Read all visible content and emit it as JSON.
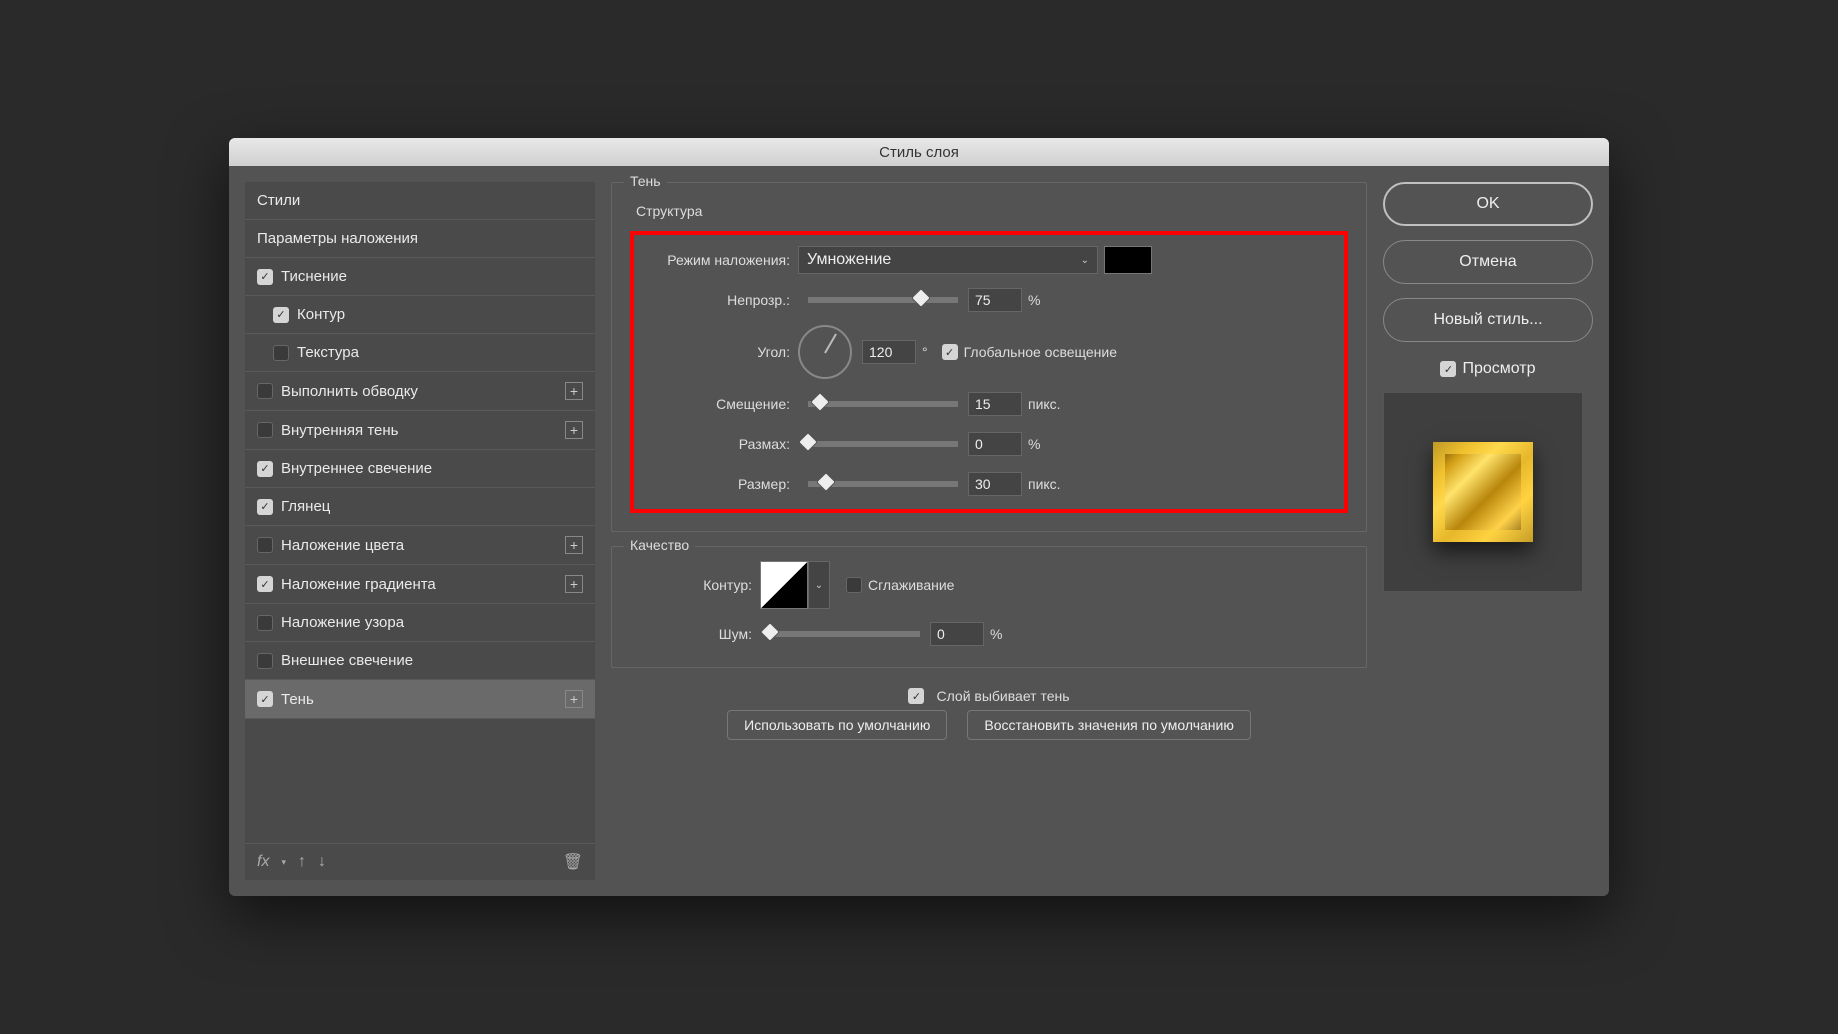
{
  "title": "Стиль слоя",
  "sidebar": {
    "styles_header": "Стили",
    "blending_options": "Параметры наложения",
    "items": [
      {
        "label": "Тиснение",
        "checked": true,
        "plus": false,
        "sub": false
      },
      {
        "label": "Контур",
        "checked": true,
        "plus": false,
        "sub": true
      },
      {
        "label": "Текстура",
        "checked": false,
        "plus": false,
        "sub": true
      },
      {
        "label": "Выполнить обводку",
        "checked": false,
        "plus": true,
        "sub": false
      },
      {
        "label": "Внутренняя тень",
        "checked": false,
        "plus": true,
        "sub": false
      },
      {
        "label": "Внутреннее свечение",
        "checked": true,
        "plus": false,
        "sub": false
      },
      {
        "label": "Глянец",
        "checked": true,
        "plus": false,
        "sub": false
      },
      {
        "label": "Наложение цвета",
        "checked": false,
        "plus": true,
        "sub": false
      },
      {
        "label": "Наложение градиента",
        "checked": true,
        "plus": true,
        "sub": false
      },
      {
        "label": "Наложение узора",
        "checked": false,
        "plus": false,
        "sub": false
      },
      {
        "label": "Внешнее свечение",
        "checked": false,
        "plus": false,
        "sub": false
      },
      {
        "label": "Тень",
        "checked": true,
        "plus": true,
        "sub": false,
        "selected": true
      }
    ],
    "fx_label": "fx"
  },
  "main": {
    "panel_title": "Тень",
    "structure": {
      "legend": "Структура",
      "blend_mode_label": "Режим наложения:",
      "blend_mode_value": "Умножение",
      "opacity_label": "Непрозр.:",
      "opacity_value": "75",
      "opacity_unit": "%",
      "angle_label": "Угол:",
      "angle_value": "120",
      "angle_unit": "°",
      "global_light_label": "Глобальное освещение",
      "global_light_checked": true,
      "distance_label": "Смещение:",
      "distance_value": "15",
      "distance_unit": "пикс.",
      "spread_label": "Размах:",
      "spread_value": "0",
      "spread_unit": "%",
      "size_label": "Размер:",
      "size_value": "30",
      "size_unit": "пикс."
    },
    "quality": {
      "legend": "Качество",
      "contour_label": "Контур:",
      "antialias_label": "Сглаживание",
      "antialias_checked": false,
      "noise_label": "Шум:",
      "noise_value": "0",
      "noise_unit": "%"
    },
    "knockout_label": "Слой выбивает тень",
    "knockout_checked": true,
    "make_default": "Использовать по умолчанию",
    "reset_default": "Восстановить значения по умолчанию"
  },
  "right": {
    "ok": "OK",
    "cancel": "Отмена",
    "new_style": "Новый стиль...",
    "preview_label": "Просмотр",
    "preview_checked": true
  }
}
